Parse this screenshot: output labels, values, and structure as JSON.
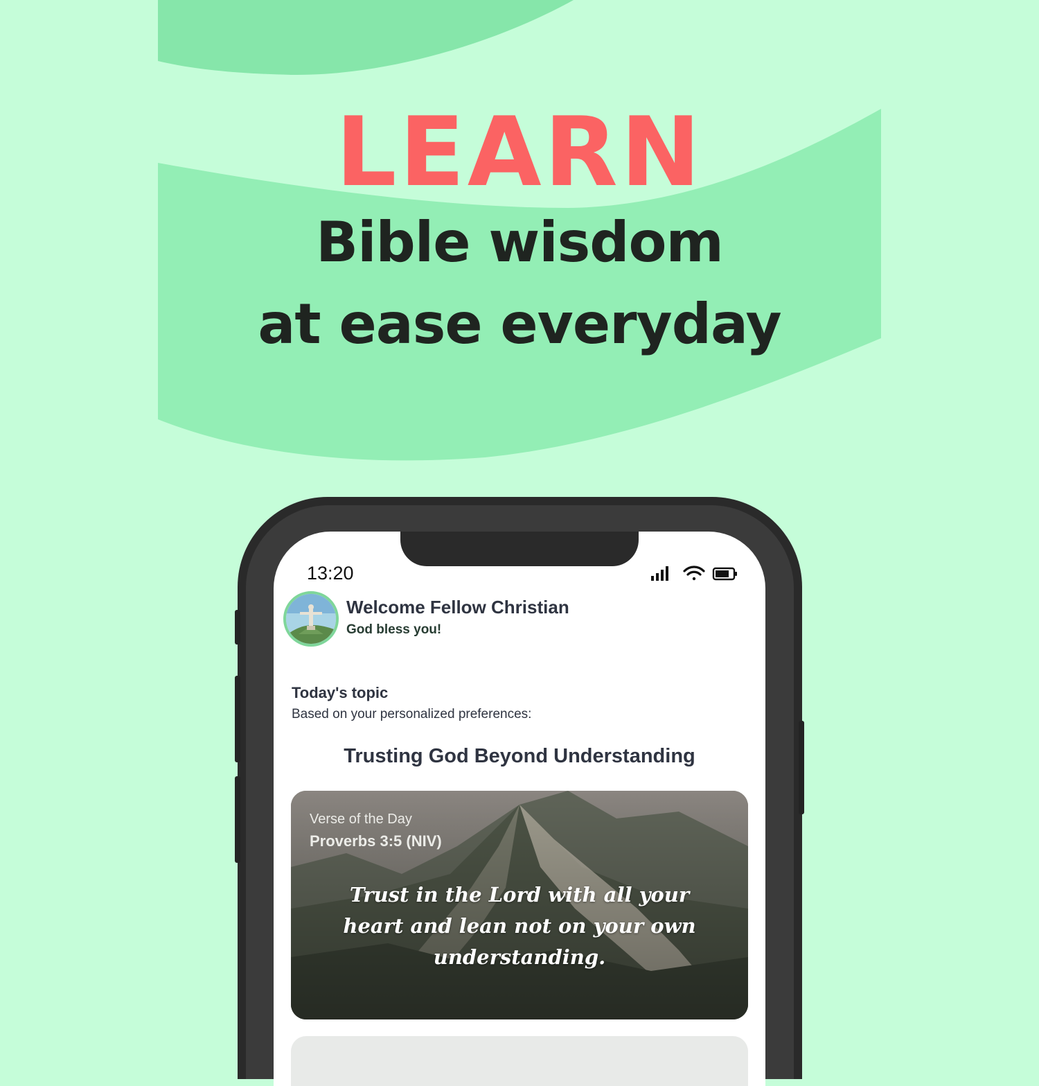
{
  "headline": {
    "word": "LEARN",
    "line1": "Bible wisdom",
    "line2": "at ease everyday"
  },
  "phone": {
    "status_bar": {
      "time": "13:20",
      "icons": [
        "signal-icon",
        "wifi-icon",
        "battery-icon"
      ]
    },
    "header": {
      "welcome": "Welcome Fellow Christian",
      "greeting": "God bless you!"
    },
    "topic": {
      "label": "Today's topic",
      "subtitle": "Based on your personalized preferences:",
      "title": "Trusting God Beyond Understanding"
    },
    "verse_card": {
      "label": "Verse of the Day",
      "reference": "Proverbs 3:5 (NIV)",
      "text": "Trust in the Lord with all your heart and lean not on your own understanding."
    }
  },
  "colors": {
    "background": "#c5fdd9",
    "wave": "#8ee8ad",
    "accent": "#fb6363",
    "text_dark": "#1f2420",
    "avatar_ring": "#7fd69a"
  }
}
